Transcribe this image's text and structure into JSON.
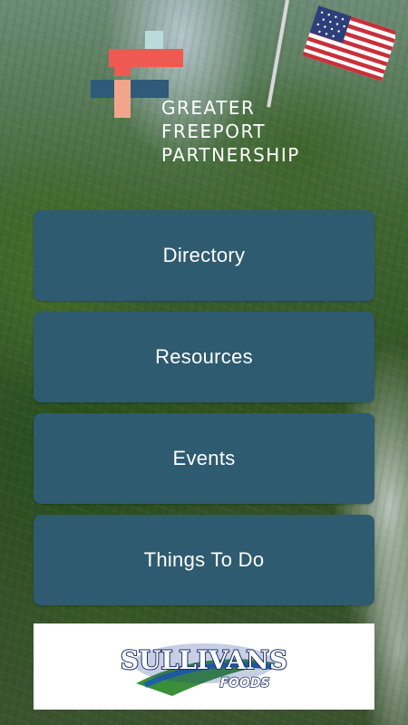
{
  "logo": {
    "line1": "GREATER",
    "line2": "FREEPORT",
    "line3": "PARTNERSHIP",
    "colors": {
      "teal": "#b9dcdb",
      "coral": "#ee5a52",
      "navy": "#2f5a78",
      "peach": "#f3a58c"
    }
  },
  "menu": {
    "items": [
      {
        "label": "Directory"
      },
      {
        "label": "Resources"
      },
      {
        "label": "Events"
      },
      {
        "label": "Things To Do"
      }
    ],
    "button_color": "#2e5b70"
  },
  "sponsor": {
    "name": "Sullivans Foods"
  }
}
